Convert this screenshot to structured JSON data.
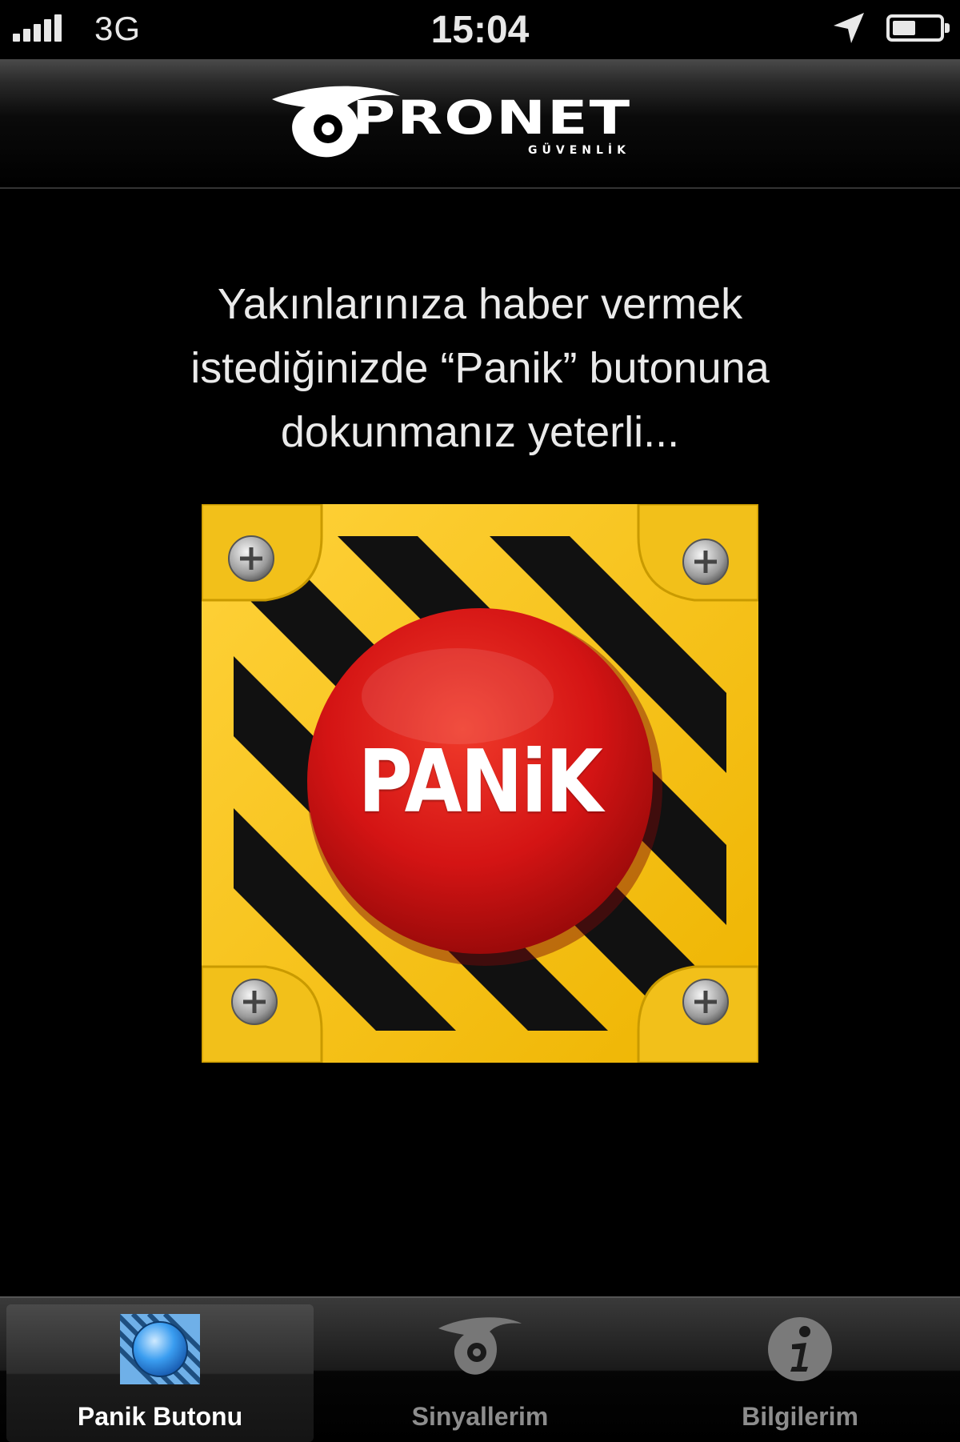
{
  "status_bar": {
    "carrier": "3G",
    "time": "15:04",
    "battery_level": 0.5
  },
  "header": {
    "logo_text": "PRONET",
    "logo_subtext": "GÜVENLİK"
  },
  "main": {
    "message_lines": [
      "Yakınlarınıza haber vermek",
      "istediğinizde “Panik” butonuna",
      "dokunmanız yeterli..."
    ],
    "panic_button_label": "PANiK"
  },
  "tabs": [
    {
      "label": "Panik Butonu",
      "icon": "panic-button-icon",
      "selected": true
    },
    {
      "label": "Sinyallerim",
      "icon": "eye-logo-icon",
      "selected": false
    },
    {
      "label": "Bilgilerim",
      "icon": "info-icon",
      "selected": false
    }
  ],
  "colors": {
    "panel_yellow": "#f6c21a",
    "button_red": "#d41414",
    "background": "#000000"
  }
}
